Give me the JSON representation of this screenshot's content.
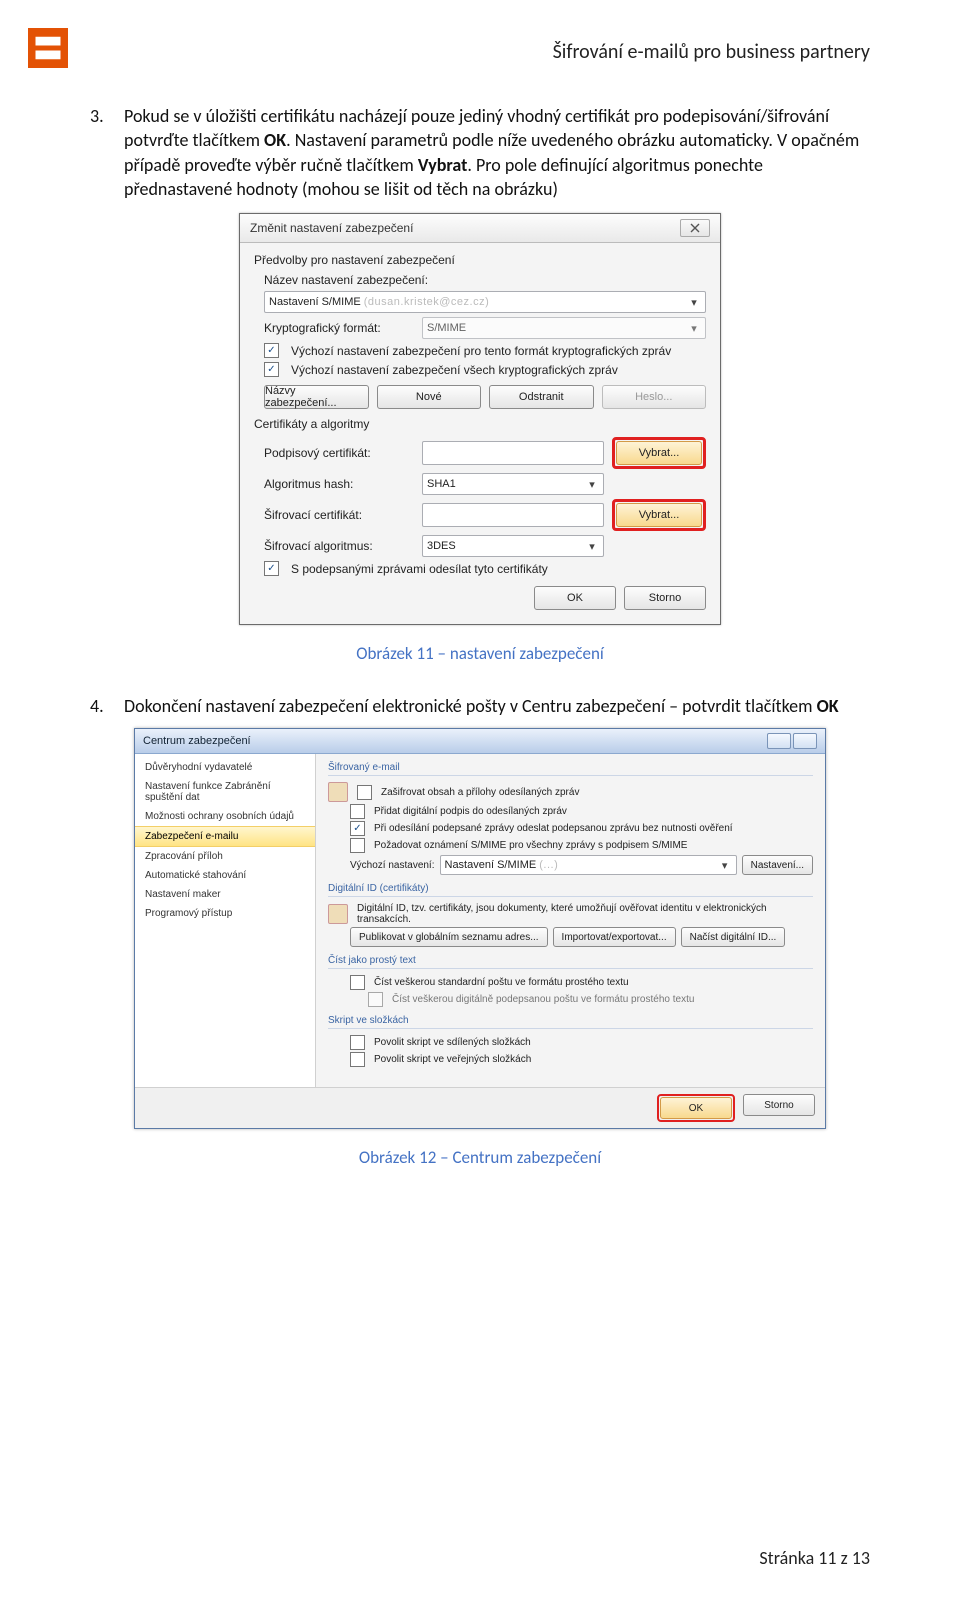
{
  "header": {
    "title": "Šifrování e-mailů pro business partnery"
  },
  "para3": {
    "num": "3.",
    "text_a": "Pokud se v úložišti certifikátu nacházejí pouze jediný vhodný certifikát pro podepisování/šifrování potvrďte tlačítkem ",
    "bold_a": "OK",
    "text_b": ". Nastavení parametrů podle níže uvedeného obrázku automaticky. V opačném případě proveďte výběr ručně tlačítkem ",
    "bold_b": "Vybrat",
    "text_c": ". Pro pole definující algoritmus ponechte přednastavené hodnoty (mohou se lišit od těch na obrázku)"
  },
  "dlg1": {
    "title": "Změnit nastavení zabezpečení",
    "legend": "Předvolby pro nastavení zabezpečení",
    "name_label": "Název nastavení zabezpečení:",
    "name_value": "Nastavení S/MIME",
    "crypto_label": "Kryptografický formát:",
    "crypto_value": "S/MIME",
    "chk1": "Výchozí nastavení zabezpečení pro tento formát kryptografických zpráv",
    "chk2": "Výchozí nastavení zabezpečení všech kryptografických zpráv",
    "btn_names": "Názvy zabezpečení...",
    "btn_new": "Nové",
    "btn_del": "Odstranit",
    "btn_pwd": "Heslo...",
    "cert_legend": "Certifikáty a algoritmy",
    "sign_cert": "Podpisový certifikát:",
    "hash": "Algoritmus hash:",
    "hash_v": "SHA1",
    "enc_cert": "Šifrovací certifikát:",
    "enc_alg": "Šifrovací algoritmus:",
    "enc_alg_v": "3DES",
    "vybrat": "Vybrat...",
    "chk3": "S podepsanými zprávami odesílat tyto certifikáty",
    "ok": "OK",
    "cancel": "Storno"
  },
  "cap1": "Obrázek 11 – nastavení zabezpečení",
  "para4": {
    "num": "4.",
    "text_a": "Dokončení nastavení zabezpečení elektronické pošty v Centru zabezpečení – potvrdit tlačítkem ",
    "bold_a": "OK"
  },
  "tc": {
    "title": "Centrum zabezpečení",
    "side": [
      "Důvěryhodní vydavatelé",
      "Nastavení funkce Zabránění spuštění dat",
      "Možnosti ochrany osobních údajů",
      "Zabezpečení e-mailu",
      "Zpracování příloh",
      "Automatické stahování",
      "Nastavení maker",
      "Programový přístup"
    ],
    "grp1": {
      "h": "Šifrovaný e-mail",
      "c1": "Zašifrovat obsah a přílohy odesílaných zpráv",
      "c2": "Přidat digitální podpis do odesílaných zpráv",
      "c3": "Při odesílání podepsané zprávy odeslat podepsanou zprávu bez nutnosti ověření",
      "c4": "Požadovat oznámení S/MIME pro všechny zprávy s podpisem S/MIME",
      "def_l": "Výchozí nastavení:",
      "def_v": "Nastavení S/MIME",
      "btn": "Nastavení..."
    },
    "grp2": {
      "h": "Digitální ID (certifikáty)",
      "desc": "Digitální ID, tzv. certifikáty, jsou dokumenty, které umožňují ověřovat identitu v elektronických transakcích.",
      "b1": "Publikovat v globálním seznamu adres...",
      "b2": "Importovat/exportovat...",
      "b3": "Načíst digitální ID..."
    },
    "grp3": {
      "h": "Číst jako prostý text",
      "c1": "Číst veškerou standardní poštu ve formátu prostého textu",
      "c2": "Číst veškerou digitálně podepsanou poštu ve formátu prostého textu"
    },
    "grp4": {
      "h": "Skript ve složkách",
      "c1": "Povolit skript ve sdílených složkách",
      "c2": "Povolit skript ve veřejných složkách"
    },
    "ok": "OK",
    "cancel": "Storno"
  },
  "cap2": "Obrázek 12 – Centrum zabezpečení",
  "footer": {
    "page": "Stránka 11 z 13"
  }
}
